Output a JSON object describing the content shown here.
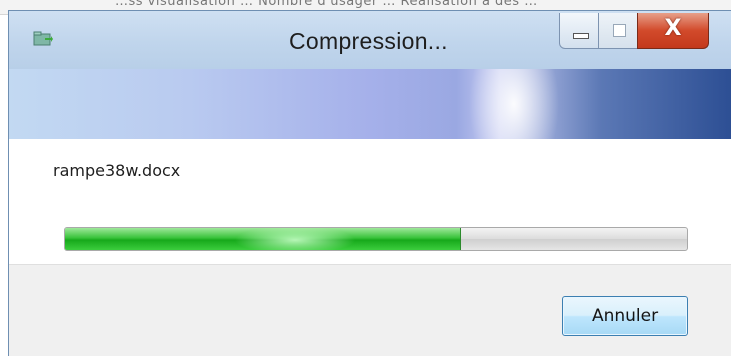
{
  "background": {
    "window_text": "…ss visualisation    … Nombre d'usager …    Réalisation à des …"
  },
  "dialog": {
    "title": "Compression...",
    "file_name": "rampe38w.docx",
    "progress_fraction": 0.635,
    "cancel_label": "Annuler",
    "close_glyph": "X",
    "icons": {
      "app": "compressed-folder-icon",
      "minimize": "minimize-icon",
      "maximize": "maximize-icon",
      "close": "close-icon"
    },
    "colors": {
      "progress": "#17a91b",
      "close_button": "#c3391c",
      "titlebar": "#c0d5ec"
    }
  }
}
